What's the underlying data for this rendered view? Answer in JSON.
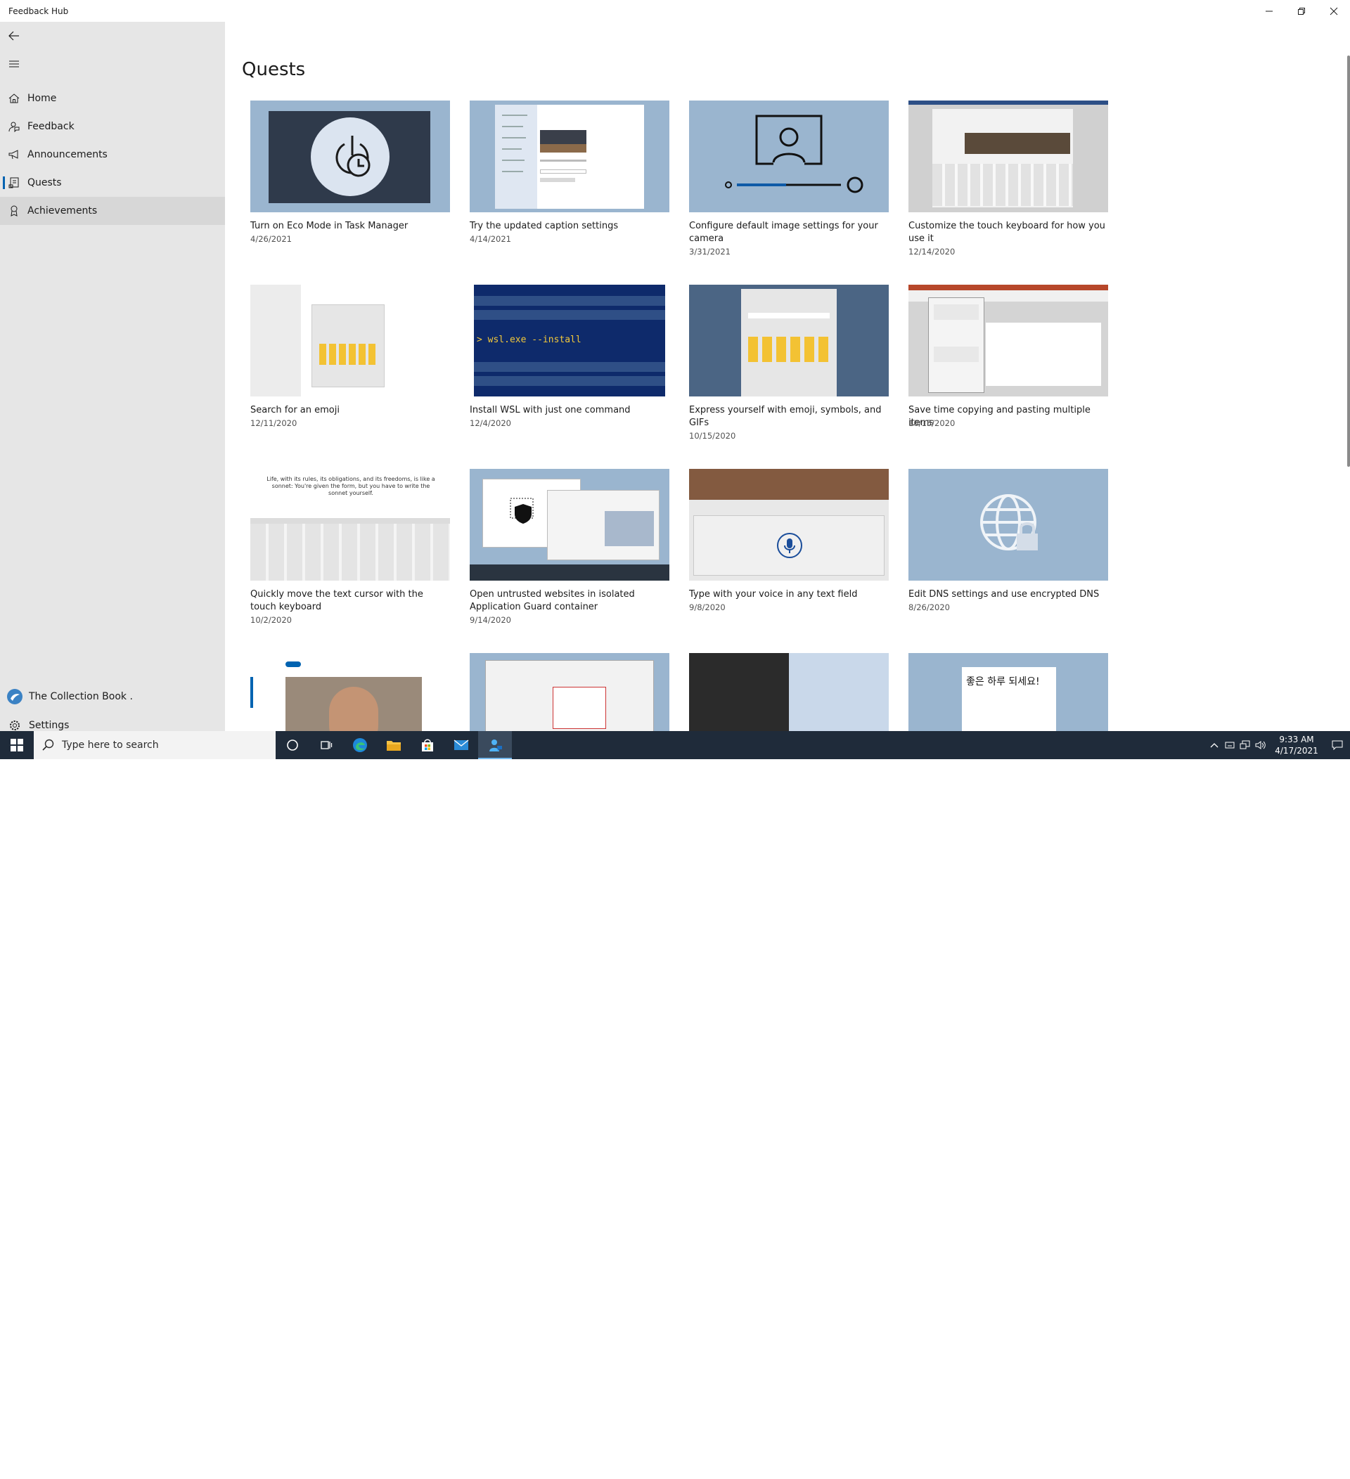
{
  "window": {
    "title": "Feedback Hub"
  },
  "sidebar": {
    "items": [
      {
        "label": "Home",
        "icon": "home-icon"
      },
      {
        "label": "Feedback",
        "icon": "feedback-icon"
      },
      {
        "label": "Announcements",
        "icon": "megaphone-icon"
      },
      {
        "label": "Quests",
        "icon": "quests-icon"
      },
      {
        "label": "Achievements",
        "icon": "achievements-icon"
      }
    ],
    "selected": "Quests",
    "hovered": "Achievements",
    "account_label": "The Collection Book .",
    "settings_label": "Settings"
  },
  "main": {
    "page_title": "Quests",
    "quests": [
      {
        "title": "Turn on Eco Mode in Task Manager",
        "date": "4/26/2021"
      },
      {
        "title": "Try the updated caption settings",
        "date": "4/14/2021"
      },
      {
        "title": "Configure default image settings for your camera",
        "date": "3/31/2021"
      },
      {
        "title": "Customize the touch keyboard for how you use it",
        "date": "12/14/2020"
      },
      {
        "title": "Search for an emoji",
        "date": "12/11/2020"
      },
      {
        "title": "Install WSL with just one command",
        "date": "12/4/2020"
      },
      {
        "title": "Express yourself with emoji, symbols, and GIFs",
        "date": "10/15/2020"
      },
      {
        "title": "Save time copying and pasting multiple items",
        "date": "10/15/2020"
      },
      {
        "title": "Quickly move the text cursor with the touch keyboard",
        "date": "10/2/2020"
      },
      {
        "title": "Open untrusted websites in isolated Application Guard container",
        "date": "9/14/2020"
      },
      {
        "title": "Type with your voice in any text field",
        "date": "9/8/2020"
      },
      {
        "title": "Edit DNS settings and use encrypted DNS",
        "date": "8/26/2020"
      }
    ],
    "thumb_texts": {
      "wsl_command": "> wsl.exe --install",
      "korean_text": "좋은 하루 되세요!",
      "cursor_text": "Life, with its rules, its obligations, and its freedoms, is like a sonnet: You're given the form, but you have to write the sonnet yourself."
    }
  },
  "taskbar": {
    "search_placeholder": "Type here to search",
    "time": "9:33 AM",
    "date": "4/17/2021",
    "watermark": "The Collection Book"
  },
  "colors": {
    "accent": "#0063b1",
    "sidebar_bg": "#e6e6e6",
    "thumb_bg": "#9ab5cf",
    "taskbar_bg": "#1f2b3a"
  }
}
